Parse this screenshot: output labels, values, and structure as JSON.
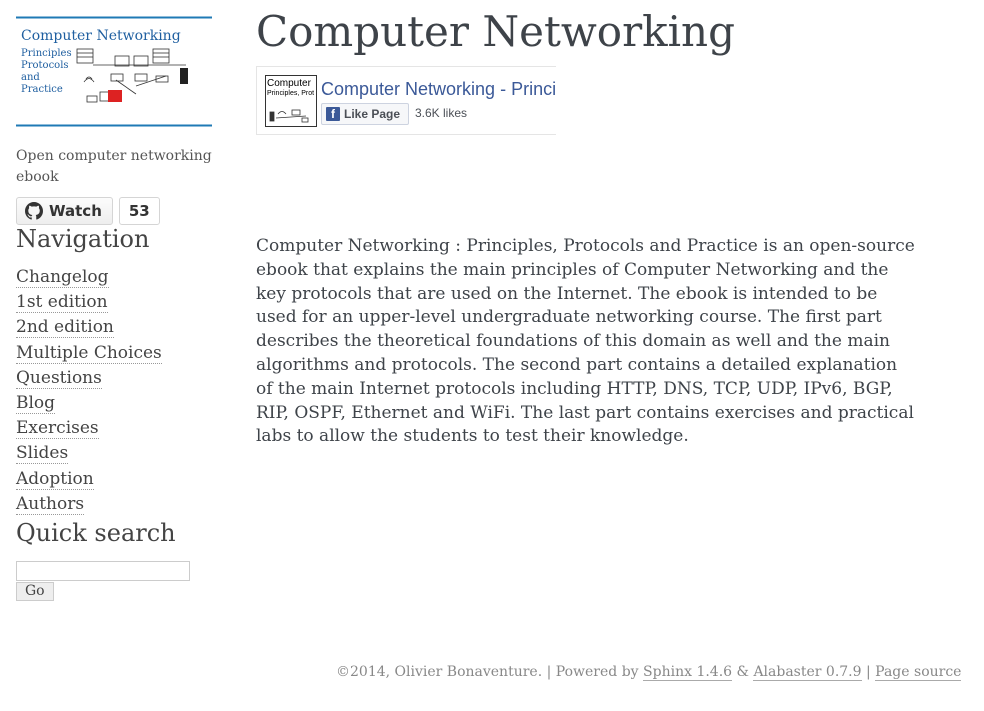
{
  "sidebar": {
    "logo": {
      "title": "Computer Networking",
      "lines": [
        "Principles",
        "Protocols",
        "and",
        "Practice"
      ]
    },
    "tagline": "Open computer networking ebook",
    "github": {
      "label": "Watch",
      "count": "53"
    },
    "nav_title": "Navigation",
    "nav_items": [
      {
        "label": "Changelog"
      },
      {
        "label": "1st edition"
      },
      {
        "label": "2nd edition"
      },
      {
        "label": "Multiple Choices"
      },
      {
        "label": "Questions"
      },
      {
        "label": "Blog"
      },
      {
        "label": "Exercises"
      },
      {
        "label": "Slides"
      },
      {
        "label": "Adoption"
      },
      {
        "label": "Authors"
      }
    ],
    "search_title": "Quick search",
    "search_button": "Go"
  },
  "main": {
    "title": "Computer Networking",
    "facebook": {
      "thumb_line1": "Computer",
      "thumb_line2": "Principles, Prot",
      "page_title": "Computer Networking - Principles, Protocols and Practice",
      "like_label": "Like Page",
      "likes": "3.6K likes",
      "brand_color": "#3b5998"
    },
    "description": "Computer Networking : Principles, Protocols and Practice is an open-source ebook that explains the main principles of Computer Networking and the key protocols that are used on the Internet. The ebook is intended to be used for an upper-level undergraduate networking course. The first part describes the theoretical foundations of this domain as well and the main algorithms and protocols. The second part contains a detailed explanation of the main Internet protocols including HTTP, DNS, TCP, UDP, IPv6, BGP, RIP, OSPF, Ethernet and WiFi. The last part contains exercises and practical labs to allow the students to test their knowledge."
  },
  "footer": {
    "copyright": "©2014, Olivier Bonaventure.",
    "sep1": " | Powered by ",
    "sphinx": "Sphinx 1.4.6",
    "amp": " & ",
    "alabaster": "Alabaster 0.7.9",
    "sep2": " | ",
    "source": "Page source"
  }
}
